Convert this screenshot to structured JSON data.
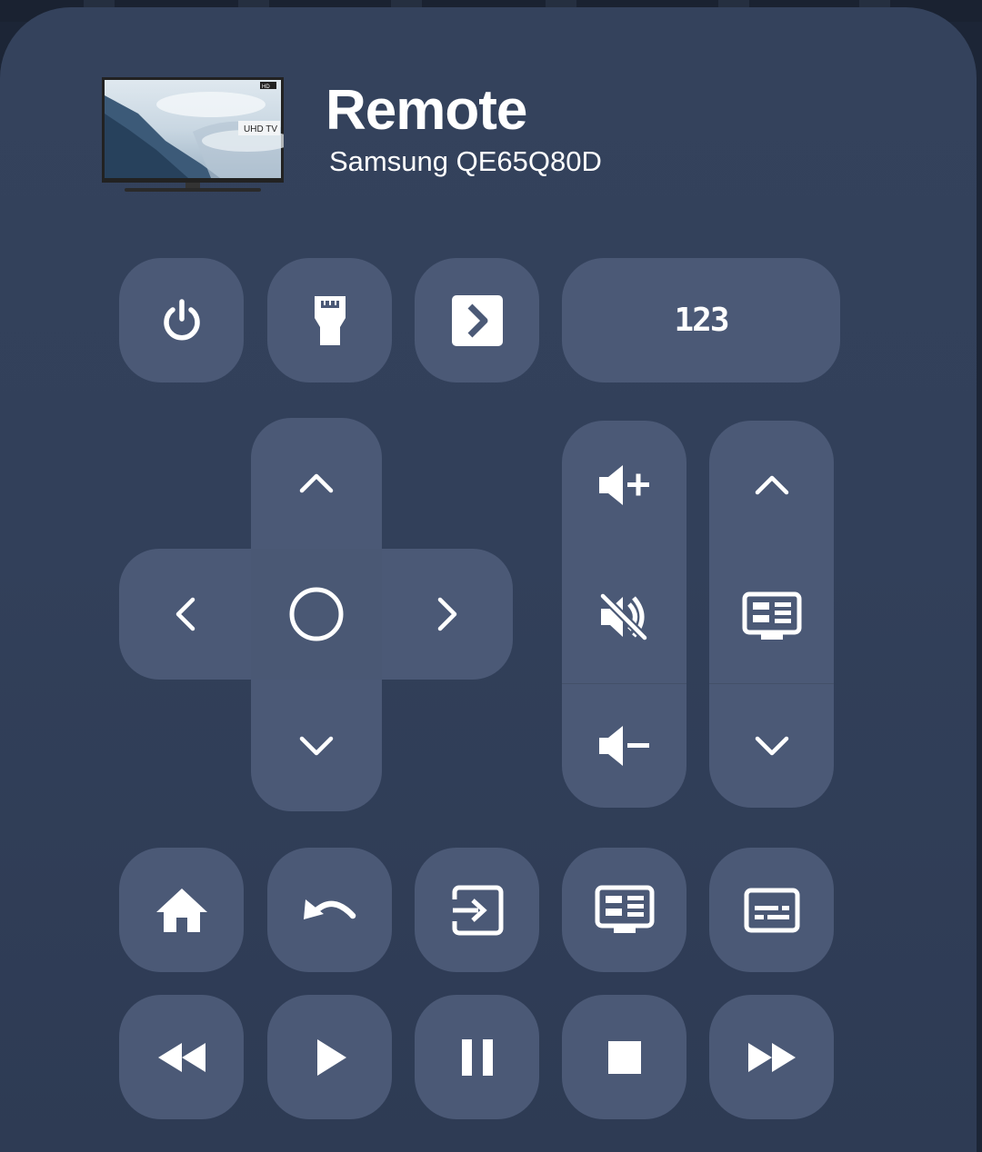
{
  "header": {
    "title": "Remote",
    "device_name": "Samsung QE65Q80D",
    "thumbnail_badge": "UHD TV",
    "thumbnail_corner": "HD"
  },
  "colors": {
    "background": "#34425c",
    "button": "#4b5976",
    "icon": "#ffffff"
  },
  "top_row": {
    "power_icon": "power-icon",
    "hdmi_icon": "hdmi-icon",
    "source_icon": "chevron-right-box-icon",
    "numpad_label": "123"
  },
  "dpad": {
    "up_icon": "chevron-up-icon",
    "down_icon": "chevron-down-icon",
    "left_icon": "chevron-left-icon",
    "right_icon": "chevron-right-icon",
    "ok_icon": "circle-icon"
  },
  "volume": {
    "up_icon": "volume-plus-icon",
    "mute_icon": "volume-off-icon",
    "down_icon": "volume-minus-icon"
  },
  "channel": {
    "up_icon": "chevron-up-icon",
    "guide_icon": "tv-guide-icon",
    "down_icon": "chevron-down-icon"
  },
  "nav_row": [
    "home-icon",
    "back-icon",
    "exit-icon",
    "tv-guide-icon",
    "subtitles-icon"
  ],
  "media_row": [
    "rewind-icon",
    "play-icon",
    "pause-icon",
    "stop-icon",
    "fast-forward-icon"
  ]
}
